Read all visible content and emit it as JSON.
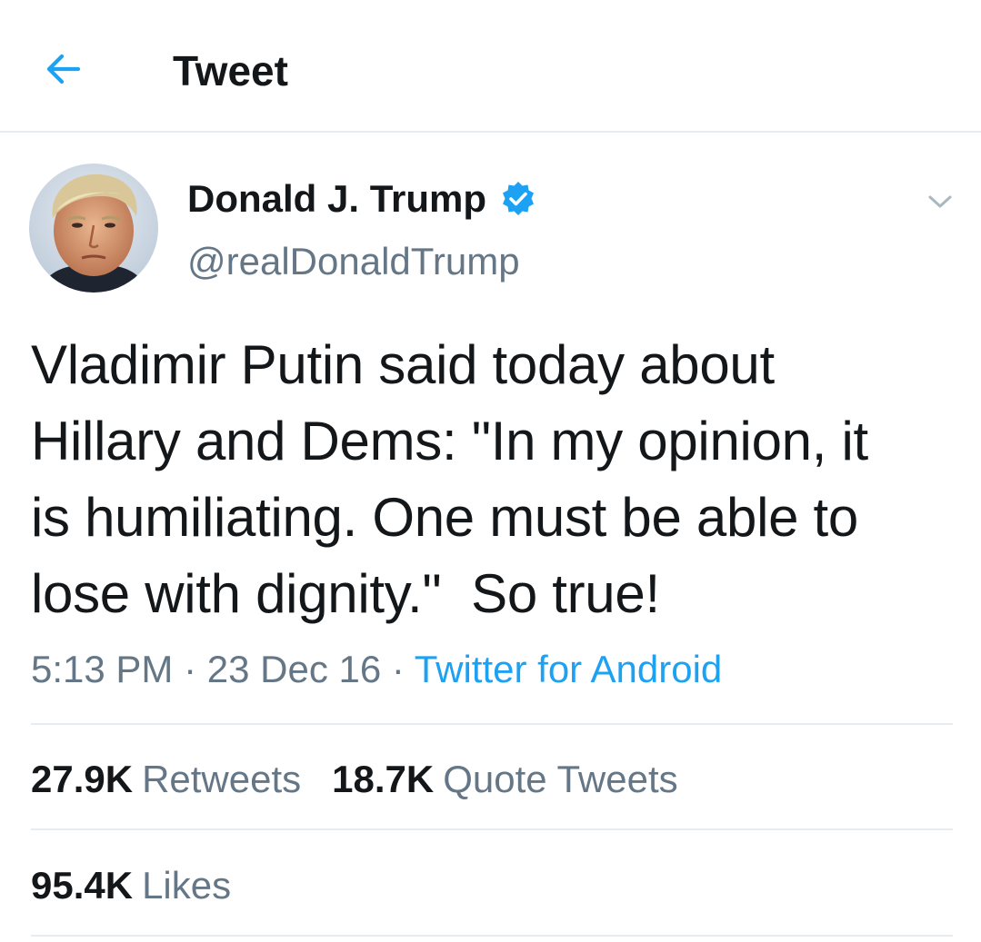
{
  "header": {
    "title": "Tweet",
    "back_icon": "arrow-left-icon",
    "accent_color": "#1da1f2"
  },
  "author": {
    "display_name": "Donald J. Trump",
    "handle": "@realDonaldTrump",
    "verified_icon": "verified-badge-icon",
    "avatar_icon": "profile-photo"
  },
  "tweet": {
    "text": "Vladimir Putin said today about\nHillary and Dems: \"In my opinion, it\nis humiliating. One must be able to\nlose with dignity.\"  So true!",
    "time": "5:13 PM",
    "separator": " · ",
    "date": "23 Dec 16",
    "source": "Twitter for Android",
    "menu_icon": "chevron-down-icon"
  },
  "stats": {
    "retweets_count": "27.9K",
    "retweets_label": "Retweets",
    "quote_count": "18.7K",
    "quote_label": "Quote Tweets",
    "likes_count": "95.4K",
    "likes_label": "Likes"
  }
}
